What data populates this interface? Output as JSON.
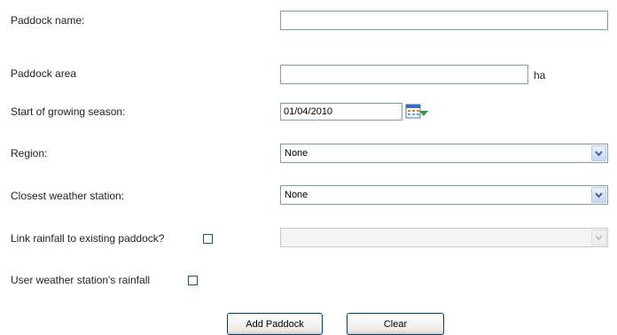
{
  "form": {
    "paddock_name": {
      "label": "Paddock name:",
      "value": ""
    },
    "paddock_area": {
      "label": "Paddock area",
      "value": "",
      "unit": "ha"
    },
    "growing_season": {
      "label": "Start of growing season:",
      "value": "01/04/2010"
    },
    "region": {
      "label": "Region:",
      "selected": "None"
    },
    "weather_station": {
      "label": "Closest weather station:",
      "selected": "None"
    },
    "link_rainfall": {
      "label": "Link rainfall to existing paddock?",
      "checked": false,
      "selected": ""
    },
    "user_rainfall": {
      "label": "User weather station's rainfall",
      "checked": false
    }
  },
  "buttons": {
    "add": "Add Paddock",
    "clear": "Clear"
  },
  "icons": {
    "calendar": "calendar-icon",
    "dropdown": "chevron-down-icon"
  },
  "colors": {
    "input_border": "#7f9db9",
    "button_border": "#003c74",
    "checkbox_border": "#1c5180"
  }
}
